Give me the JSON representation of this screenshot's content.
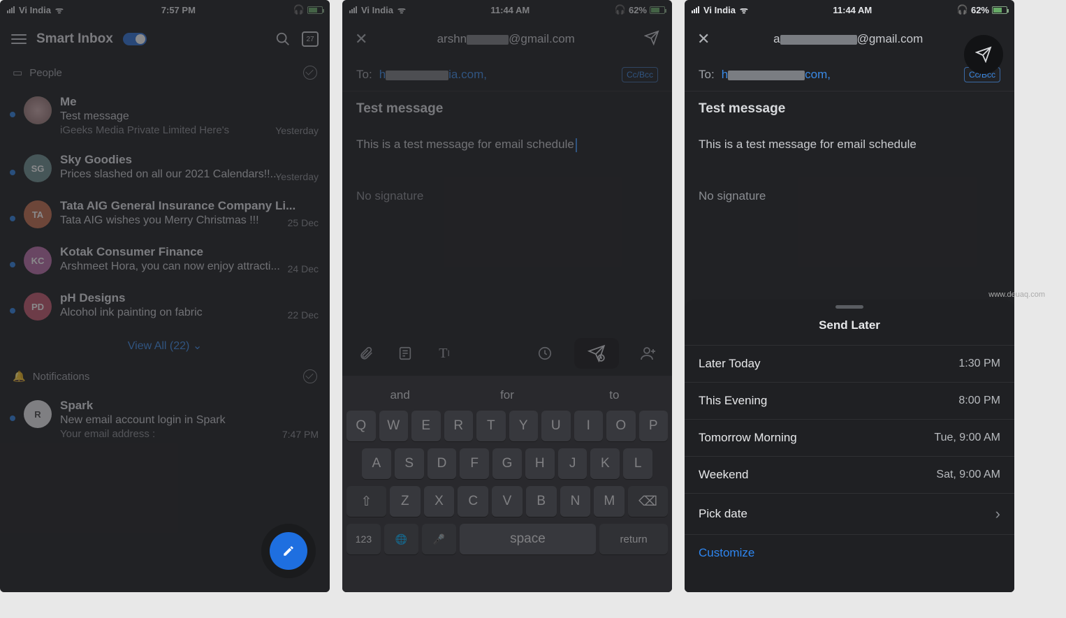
{
  "watermark": "www.deuaq.com",
  "screen1": {
    "statusbar": {
      "carrier": "Vi India",
      "time": "7:57 PM"
    },
    "title": "Smart Inbox",
    "calendar_day": "27",
    "section_people": "People",
    "viewall": "View All (22)",
    "section_notifications": "Notifications",
    "emails": [
      {
        "sender": "Me",
        "subject": "Test message",
        "preview": "iGeeks Media Private Limited Here's",
        "date": "Yesterday",
        "initials": "",
        "color": "#6a6"
      },
      {
        "sender": "Sky Goodies",
        "subject": "Prices slashed on all our 2021 Calendars!!...",
        "preview": "",
        "date": "Yesterday",
        "initials": "SG",
        "color": "#6a8e8e"
      },
      {
        "sender": "Tata AIG General Insurance Company Li...",
        "subject": "Tata AIG wishes you Merry Christmas !!!",
        "preview": "",
        "date": "25 Dec",
        "initials": "TA",
        "color": "#c26a4a"
      },
      {
        "sender": "Kotak Consumer Finance",
        "subject": "Arshmeet Hora, you can now enjoy attracti...",
        "preview": "",
        "date": "24 Dec",
        "initials": "KC",
        "color": "#b96aa6"
      },
      {
        "sender": "pH Designs",
        "subject": "Alcohol ink painting on fabric",
        "preview": "",
        "date": "22 Dec",
        "initials": "PD",
        "color": "#c2556a"
      }
    ],
    "notif": {
      "sender": "Spark",
      "subject": "New email account login in Spark",
      "preview": "Your email address :",
      "date": "7:47 PM"
    }
  },
  "screen2": {
    "statusbar": {
      "carrier": "Vi India",
      "time": "11:44 AM",
      "batt": "62%"
    },
    "from_prefix": "arshn",
    "from_suffix": "@gmail.com",
    "to_label": "To:",
    "to_prefix": "h",
    "to_suffix": "ia.com,",
    "ccbcc": "Cc/Bcc",
    "subject": "Test message",
    "body": "This is a test message for email schedule",
    "nosig": "No signature",
    "suggest": [
      "and",
      "for",
      "to"
    ],
    "rows": [
      [
        "Q",
        "W",
        "E",
        "R",
        "T",
        "Y",
        "U",
        "I",
        "O",
        "P"
      ],
      [
        "A",
        "S",
        "D",
        "F",
        "G",
        "H",
        "J",
        "K",
        "L"
      ],
      [
        "Z",
        "X",
        "C",
        "V",
        "B",
        "N",
        "M"
      ]
    ],
    "k123": "123",
    "kspace": "space",
    "kreturn": "return"
  },
  "screen3": {
    "statusbar": {
      "carrier": "Vi India",
      "time": "11:44 AM",
      "batt": "62%"
    },
    "from_prefix": "a",
    "from_suffix": "@gmail.com",
    "to_label": "To:",
    "to_prefix": "h",
    "to_suffix": "com,",
    "ccbcc": "Cc/Bcc",
    "subject": "Test message",
    "body": "This is a test message for email schedule",
    "nosig": "No signature",
    "sheet": {
      "title": "Send Later",
      "rows": [
        {
          "label": "Later Today",
          "value": "1:30 PM"
        },
        {
          "label": "This Evening",
          "value": "8:00 PM"
        },
        {
          "label": "Tomorrow Morning",
          "value": "Tue, 9:00 AM"
        },
        {
          "label": "Weekend",
          "value": "Sat, 9:00 AM"
        }
      ],
      "pickdate": "Pick date",
      "customize": "Customize"
    }
  }
}
